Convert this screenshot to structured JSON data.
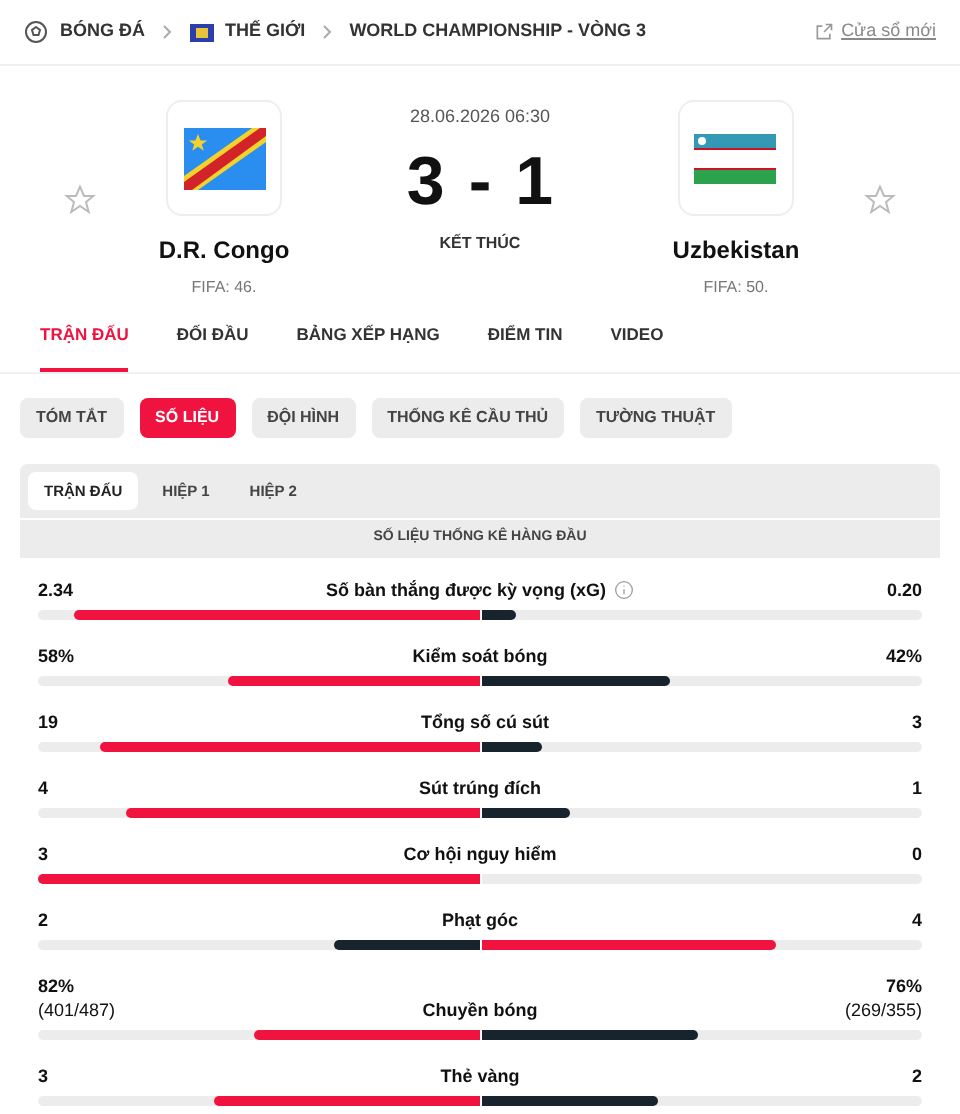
{
  "breadcrumb": [
    {
      "label": "BÓNG ĐÁ",
      "kind": "ball"
    },
    {
      "label": "THẾ GIỚI",
      "kind": "flag"
    },
    {
      "label": "WORLD CHAMPIONSHIP - VÒNG 3",
      "kind": "none"
    }
  ],
  "new_window_link": "Cửa sổ mới",
  "match": {
    "datetime": "28.06.2026 06:30",
    "score_home": "3",
    "score_separator": "-",
    "score_away": "1",
    "status": "KẾT THÚC",
    "home": {
      "name": "D.R. Congo",
      "rank": "FIFA: 46.",
      "kind": "drc",
      "favorite": false
    },
    "away": {
      "name": "Uzbekistan",
      "rank": "FIFA: 50.",
      "kind": "uzb",
      "favorite": false
    }
  },
  "tabs": [
    {
      "label": "TRẬN ĐẤU",
      "selected": true
    },
    {
      "label": "ĐỐI ĐẦU",
      "selected": false
    },
    {
      "label": "BẢNG XẾP HẠNG",
      "selected": false
    },
    {
      "label": "ĐIỂM TIN",
      "selected": false
    },
    {
      "label": "VIDEO",
      "selected": false
    }
  ],
  "subtabs": [
    {
      "label": "TÓM TẮT",
      "selected": false
    },
    {
      "label": "SỐ LIỆU",
      "selected": true
    },
    {
      "label": "ĐỘI HÌNH",
      "selected": false
    },
    {
      "label": "THỐNG KÊ CẦU THỦ",
      "selected": false
    },
    {
      "label": "TƯỜNG THUẬT",
      "selected": false
    }
  ],
  "period_tabs": [
    {
      "label": "TRẬN ĐẤU",
      "selected": true
    },
    {
      "label": "HIỆP 1",
      "selected": false
    },
    {
      "label": "HIỆP 2",
      "selected": false
    }
  ],
  "section_title": "SỐ LIỆU THỐNG KÊ HÀNG ĐẦU",
  "stats": [
    {
      "label": "Số bàn thắng được kỳ vọng (xG)",
      "info": true,
      "home": {
        "value": "2.34",
        "level": 0.92,
        "leading": true
      },
      "away": {
        "value": "0.20",
        "level": 0.08,
        "leading": false
      }
    },
    {
      "label": "Kiểm soát bóng",
      "info": false,
      "home": {
        "value": "58%",
        "level": 0.57,
        "leading": true
      },
      "away": {
        "value": "42%",
        "level": 0.43,
        "leading": false
      }
    },
    {
      "label": "Tổng số cú sút",
      "info": false,
      "home": {
        "value": "19",
        "level": 0.86,
        "leading": true
      },
      "away": {
        "value": "3",
        "level": 0.14,
        "leading": false
      }
    },
    {
      "label": "Sút trúng đích",
      "info": false,
      "home": {
        "value": "4",
        "level": 0.8,
        "leading": true
      },
      "away": {
        "value": "1",
        "level": 0.2,
        "leading": false
      }
    },
    {
      "label": "Cơ hội nguy hiểm",
      "info": false,
      "home": {
        "value": "3",
        "level": 1,
        "leading": true
      },
      "away": {
        "value": "0",
        "level": 0
      }
    },
    {
      "label": "Phạt góc",
      "info": false,
      "home": {
        "value": "2",
        "level": 0.33,
        "leading": false
      },
      "away": {
        "value": "4",
        "level": 0.67,
        "leading": true
      }
    },
    {
      "label": "Chuyền bóng",
      "info": false,
      "home": {
        "value": "82%",
        "detail": "(401/487)",
        "level": 0.51,
        "leading": true
      },
      "away": {
        "value": "76%",
        "detail": "(269/355)",
        "level": 0.49,
        "leading": false
      }
    },
    {
      "label": "Thẻ vàng",
      "info": false,
      "home": {
        "value": "3",
        "level": 0.6,
        "leading": true
      },
      "away": {
        "value": "2",
        "level": 0.4,
        "leading": false
      }
    }
  ]
}
